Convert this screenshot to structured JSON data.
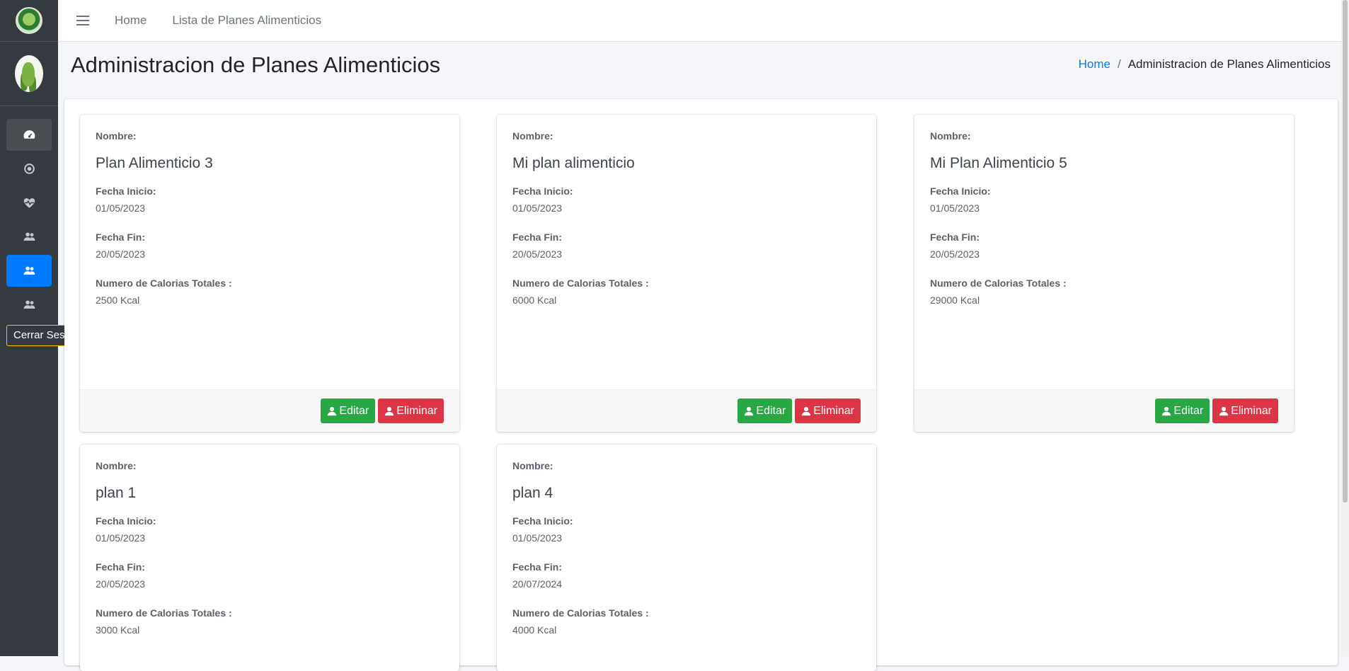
{
  "sidebar": {
    "nav_icons": [
      "dashboard-icon",
      "circle-dot-icon",
      "heartbeat-icon",
      "users-icon",
      "users-icon",
      "users-icon"
    ],
    "logout_label": "Cerrar Sesión"
  },
  "topbar": {
    "links": [
      "Home",
      "Lista de Planes Alimenticios"
    ]
  },
  "header": {
    "title": "Administracion de Planes Alimenticios",
    "breadcrumb_home": "Home",
    "breadcrumb_current": "Administracion de Planes Alimenticios"
  },
  "labels": {
    "nombre": "Nombre:",
    "fecha_inicio": "Fecha Inicio:",
    "fecha_fin": "Fecha Fin:",
    "calorias": "Numero de Calorias Totales :",
    "edit_button": "Editar",
    "delete_button": "Eliminar"
  },
  "plans": [
    {
      "nombre": "Plan Alimenticio 3",
      "fecha_inicio": "01/05/2023",
      "fecha_fin": "20/05/2023",
      "calorias": "2500 Kcal"
    },
    {
      "nombre": "Mi plan alimenticio",
      "fecha_inicio": "01/05/2023",
      "fecha_fin": "20/05/2023",
      "calorias": "6000 Kcal"
    },
    {
      "nombre": "Mi Plan Alimenticio 5",
      "fecha_inicio": "01/05/2023",
      "fecha_fin": "20/05/2023",
      "calorias": "29000 Kcal"
    },
    {
      "nombre": "plan 1",
      "fecha_inicio": "01/05/2023",
      "fecha_fin": "20/05/2023",
      "calorias": "3000 Kcal"
    },
    {
      "nombre": "plan 4",
      "fecha_inicio": "01/05/2023",
      "fecha_fin": "20/07/2024",
      "calorias": "4000 Kcal"
    }
  ],
  "colors": {
    "sidebar_bg": "#343a40",
    "primary": "#007bff",
    "success": "#28a745",
    "danger": "#dc3545"
  }
}
